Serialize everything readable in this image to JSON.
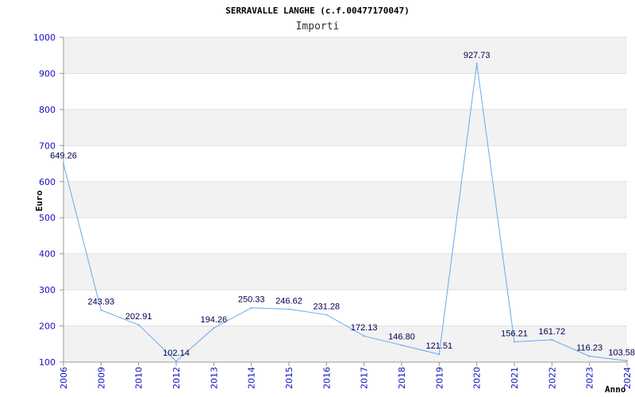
{
  "chart_data": {
    "type": "line",
    "title": "SERRAVALLE LANGHE (c.f.00477170047)",
    "subtitle": "Importi",
    "xlabel": "Anno",
    "ylabel": "Euro",
    "ylim": [
      100,
      1000
    ],
    "yticks": [
      "100",
      "200",
      "300",
      "400",
      "500",
      "600",
      "700",
      "800",
      "900",
      "1000"
    ],
    "grid": "horizontal bands",
    "categories": [
      "2006",
      "2009",
      "2010",
      "2012",
      "2013",
      "2014",
      "2015",
      "2016",
      "2017",
      "2018",
      "2019",
      "2020",
      "2021",
      "2022",
      "2023",
      "2024"
    ],
    "values": [
      649.26,
      243.93,
      202.91,
      102.14,
      194.26,
      250.33,
      246.62,
      231.28,
      172.13,
      146.8,
      121.51,
      927.73,
      156.21,
      161.72,
      116.23,
      103.58
    ],
    "labels": [
      "649.26",
      "243.93",
      "202.91",
      "102.14",
      "194.26",
      "250.33",
      "246.62",
      "231.28",
      "172.13",
      "146.80",
      "121.51",
      "927.73",
      "156.21",
      "161.72",
      "116.23",
      "103.58"
    ],
    "colors": {
      "line": "#66aaee",
      "tick": "#1010c0",
      "band": "#f2f2f2",
      "grid": "#e0e0e0",
      "axis": "#999999"
    }
  }
}
